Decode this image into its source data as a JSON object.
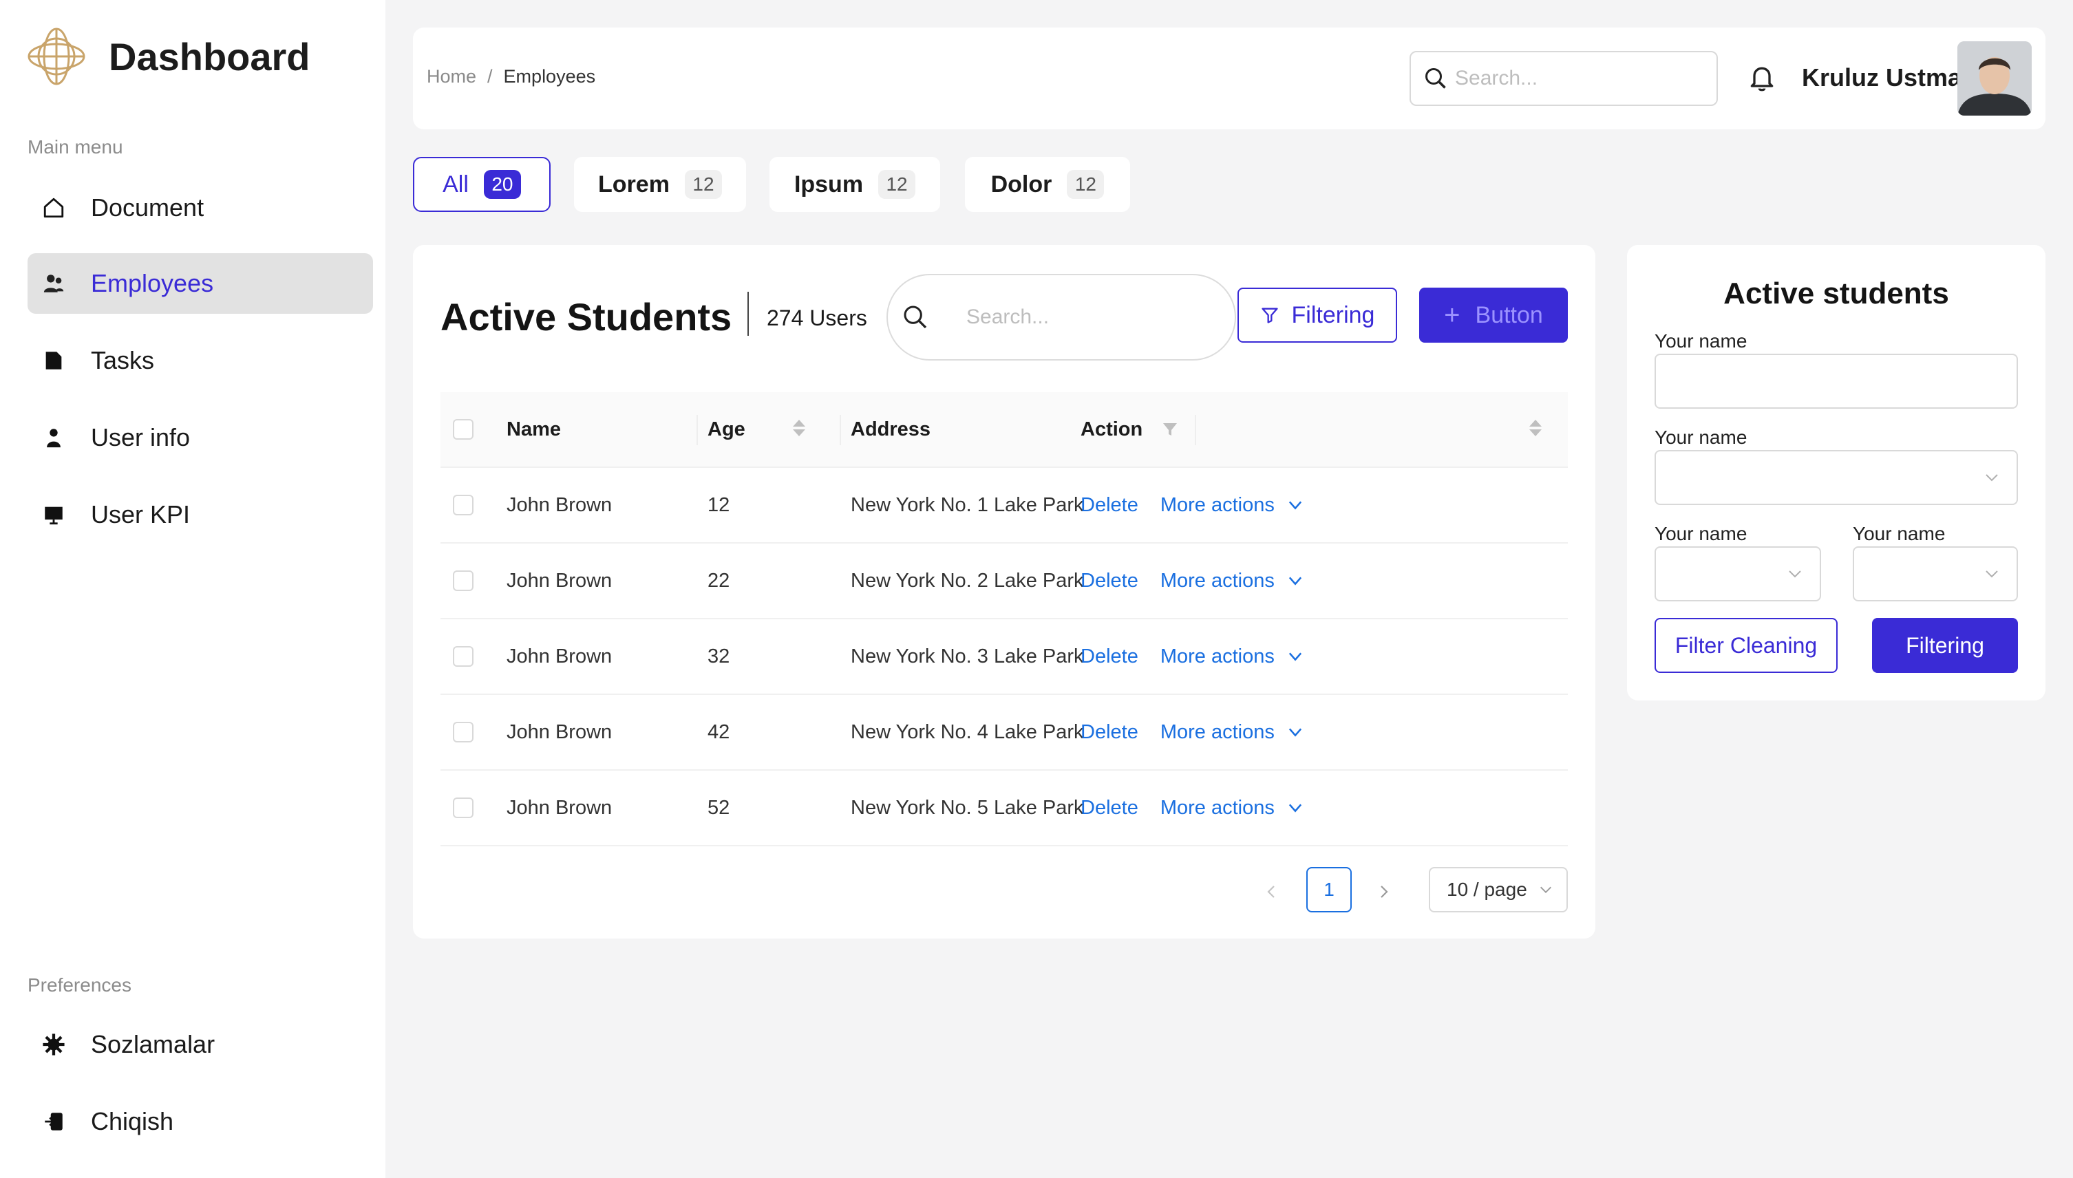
{
  "sidebar": {
    "brand_title": "Dashboard",
    "main_menu_label": "Main menu",
    "items": [
      {
        "label": "Document",
        "icon": "home-icon",
        "active": false
      },
      {
        "label": "Employees",
        "icon": "users-icon",
        "active": true
      },
      {
        "label": "Tasks",
        "icon": "tasks-icon",
        "active": false
      },
      {
        "label": "User info",
        "icon": "user-icon",
        "active": false
      },
      {
        "label": "User KPI",
        "icon": "presentation-icon",
        "active": false
      }
    ],
    "preferences_label": "Preferences",
    "pref_items": [
      {
        "label": "Sozlamalar",
        "icon": "gear-icon"
      },
      {
        "label": "Chiqish",
        "icon": "logout-icon"
      }
    ]
  },
  "header": {
    "breadcrumb": {
      "home": "Home",
      "separator": "/",
      "current": "Employees"
    },
    "search_placeholder": "Search...",
    "user_name": "Kruluz Ustman"
  },
  "tabs": [
    {
      "label": "All",
      "count": "20",
      "active": true
    },
    {
      "label": "Lorem",
      "count": "12",
      "active": false
    },
    {
      "label": "Ipsum",
      "count": "12",
      "active": false
    },
    {
      "label": "Dolor",
      "count": "12",
      "active": false
    }
  ],
  "main": {
    "title": "Active Students",
    "user_count": "274 Users",
    "search_placeholder": "Search...",
    "filter_button": "Filtering",
    "primary_button": "Button",
    "table": {
      "columns": [
        "Name",
        "Age",
        "Address",
        "Action"
      ],
      "rows": [
        {
          "name": "John Brown",
          "age": "12",
          "address": "New York No. 1 Lake Park",
          "delete": "Delete",
          "more": "More actions"
        },
        {
          "name": "John Brown",
          "age": "22",
          "address": "New York No. 2 Lake Park",
          "delete": "Delete",
          "more": "More actions"
        },
        {
          "name": "John Brown",
          "age": "32",
          "address": "New York No. 3 Lake Park",
          "delete": "Delete",
          "more": "More actions"
        },
        {
          "name": "John Brown",
          "age": "42",
          "address": "New York No. 4 Lake Park",
          "delete": "Delete",
          "more": "More actions"
        },
        {
          "name": "John Brown",
          "age": "52",
          "address": "New York No. 5 Lake Park",
          "delete": "Delete",
          "more": "More actions"
        }
      ]
    },
    "pagination": {
      "current_page": "1",
      "page_size": "10 / page"
    }
  },
  "right_panel": {
    "title": "Active students",
    "fields": [
      {
        "label": "Your name",
        "type": "text",
        "value": ""
      },
      {
        "label": "Your name",
        "type": "select",
        "value": ""
      },
      {
        "label": "Your name",
        "type": "select",
        "value": ""
      },
      {
        "label": "Your name",
        "type": "select",
        "value": ""
      }
    ],
    "clean_button": "Filter Cleaning",
    "filter_button": "Filtering"
  },
  "colors": {
    "accent": "#3a2bd6",
    "link": "#1a6fe0",
    "sidebar_active_bg": "#e2e2e2",
    "page_bg": "#f4f4f5"
  }
}
